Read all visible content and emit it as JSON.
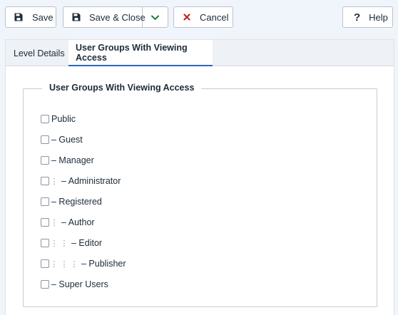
{
  "toolbar": {
    "save_label": "Save",
    "save_close_label": "Save & Close",
    "cancel_label": "Cancel",
    "help_label": "Help",
    "help_icon_glyph": "?"
  },
  "tabs": [
    {
      "label": "Level Details",
      "active": false
    },
    {
      "label": "User Groups With Viewing Access",
      "active": true
    }
  ],
  "fieldset": {
    "legend": "User Groups With Viewing Access"
  },
  "groups": [
    {
      "name": "Public",
      "depth": 0,
      "checked": false
    },
    {
      "name": "– Guest",
      "depth": 0,
      "checked": false
    },
    {
      "name": "– Manager",
      "depth": 0,
      "checked": false
    },
    {
      "name": "– Administrator",
      "depth": 1,
      "checked": false
    },
    {
      "name": "– Registered",
      "depth": 0,
      "checked": false
    },
    {
      "name": "– Author",
      "depth": 1,
      "checked": false
    },
    {
      "name": "– Editor",
      "depth": 2,
      "checked": false
    },
    {
      "name": "– Publisher",
      "depth": 3,
      "checked": false
    },
    {
      "name": "– Super Users",
      "depth": 0,
      "checked": false
    }
  ],
  "colors": {
    "accent": "#2a69b8",
    "cancel_icon": "#c52827",
    "save_close_chevron": "#1e7d3a"
  },
  "icons": {
    "save": "floppy-disk-icon",
    "save_close": "floppy-disk-icon",
    "dropdown": "chevron-down-icon",
    "cancel": "x-icon",
    "help": "question-mark-icon"
  }
}
